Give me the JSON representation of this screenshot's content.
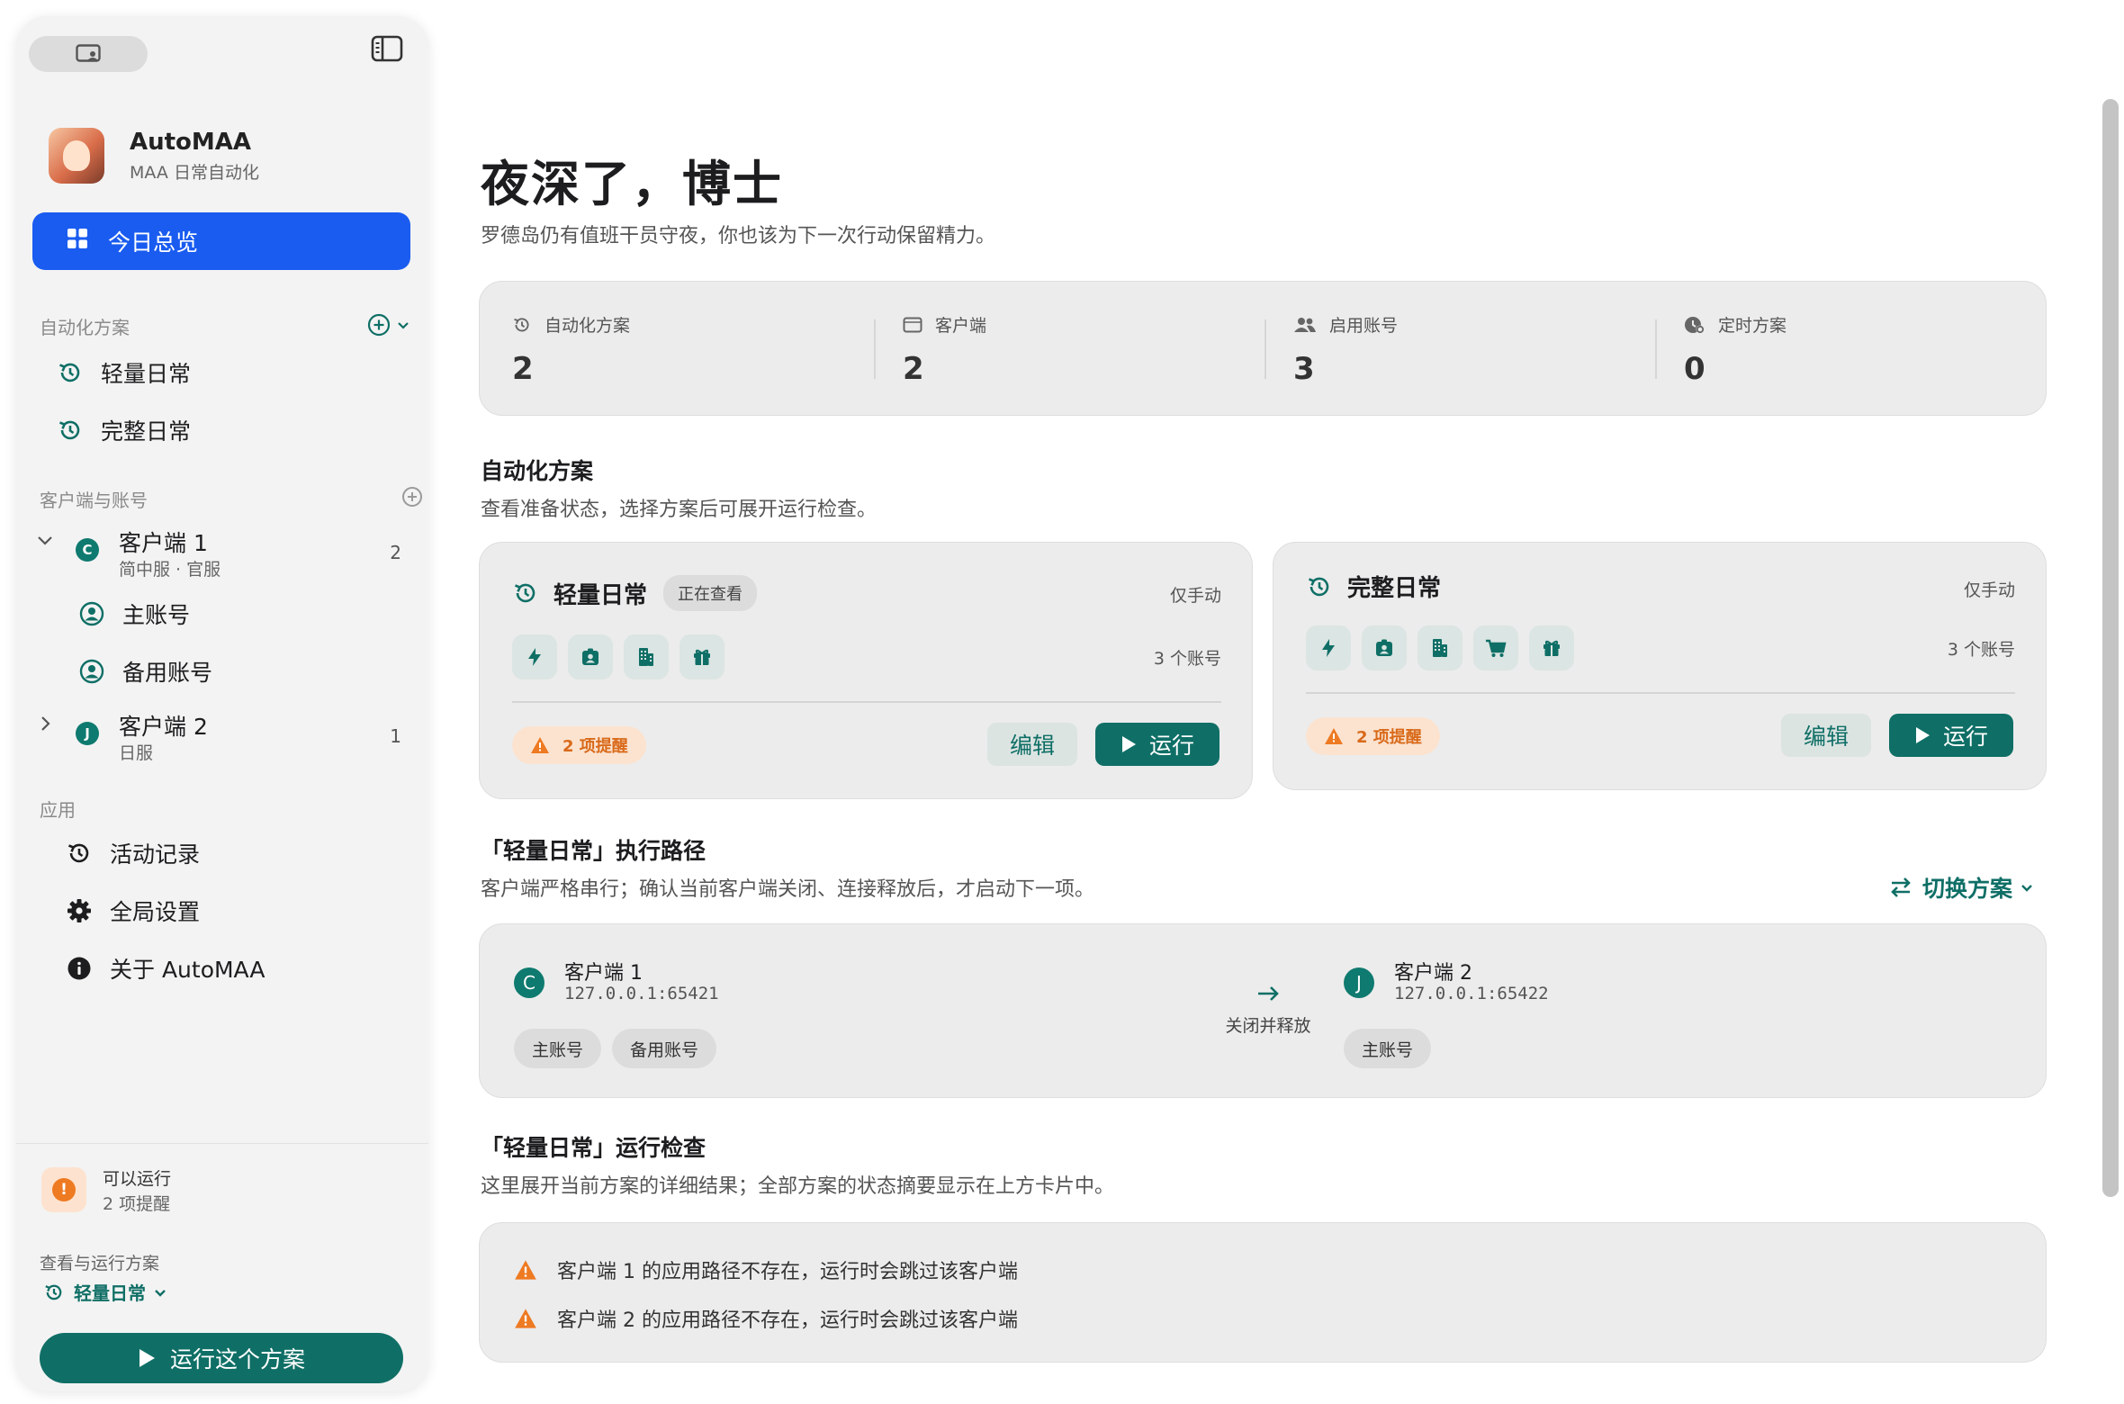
{
  "sidebar": {
    "app": {
      "name": "AutoMAA",
      "subtitle": "MAA 日常自动化"
    },
    "nav_active": "今日总览",
    "sections": {
      "plans": "自动化方案",
      "clients": "客户端与账号",
      "app": "应用"
    },
    "plans": [
      {
        "label": "轻量日常",
        "icon": "history-icon"
      },
      {
        "label": "完整日常",
        "icon": "history-icon"
      }
    ],
    "clients": [
      {
        "badge": "C",
        "name": "客户端 1",
        "sub": "简中服 · 官服",
        "count": "2",
        "expanded": true,
        "accounts": [
          "主账号",
          "备用账号"
        ]
      },
      {
        "badge": "J",
        "name": "客户端 2",
        "sub": "日服",
        "count": "1",
        "expanded": false
      }
    ],
    "app_items": [
      {
        "label": "活动记录",
        "icon": "history-icon"
      },
      {
        "label": "全局设置",
        "icon": "gear-icon"
      },
      {
        "label": "关于 AutoMAA",
        "icon": "info-icon"
      }
    ],
    "footer": {
      "status": "可以运行",
      "warnings": "2 项提醒",
      "view_label": "查看与运行方案",
      "selected_plan": "轻量日常",
      "run_button": "运行这个方案"
    }
  },
  "main": {
    "greeting": "夜深了，博士",
    "greeting_sub": "罗德岛仍有值班干员守夜，你也该为下一次行动保留精力。",
    "stats": [
      {
        "label": "自动化方案",
        "value": "2",
        "icon": "history-icon"
      },
      {
        "label": "客户端",
        "value": "2",
        "icon": "window-icon"
      },
      {
        "label": "启用账号",
        "value": "3",
        "icon": "users-icon"
      },
      {
        "label": "定时方案",
        "value": "0",
        "icon": "timer-icon"
      }
    ],
    "plans_section": {
      "title": "自动化方案",
      "desc": "查看准备状态，选择方案后可展开运行检查。"
    },
    "plan_cards": [
      {
        "name": "轻量日常",
        "viewing": "正在查看",
        "mode": "仅手动",
        "accounts": "3 个账号",
        "icons": [
          "bolt-icon",
          "badge-icon",
          "building-icon",
          "gift-icon"
        ],
        "warnings": "2 项提醒",
        "edit": "编辑",
        "run": "运行"
      },
      {
        "name": "完整日常",
        "viewing": "",
        "mode": "仅手动",
        "accounts": "3 个账号",
        "icons": [
          "bolt-icon",
          "badge-icon",
          "building-icon",
          "cart-icon",
          "gift-icon"
        ],
        "warnings": "2 项提醒",
        "edit": "编辑",
        "run": "运行"
      }
    ],
    "path_section": {
      "title": "「轻量日常」执行路径",
      "desc": "客户端严格串行；确认当前客户端关闭、连接释放后，才启动下一项。",
      "switch": "切换方案",
      "nodes": [
        {
          "badge": "C",
          "name": "客户端 1",
          "addr": "127.0.0.1:65421",
          "accounts": [
            "主账号",
            "备用账号"
          ]
        },
        {
          "badge": "J",
          "name": "客户端 2",
          "addr": "127.0.0.1:65422",
          "accounts": [
            "主账号"
          ]
        }
      ],
      "arrow_label": "关闭并释放"
    },
    "check_section": {
      "title": "「轻量日常」运行检查",
      "desc": "这里展开当前方案的详细结果；全部方案的状态摘要显示在上方卡片中。",
      "items": [
        "客户端 1 的应用路径不存在，运行时会跳过该客户端",
        "客户端 2 的应用路径不存在，运行时会跳过该客户端"
      ]
    }
  },
  "colors": {
    "primary": "#1a5cf0",
    "teal": "#0f6f66",
    "warning": "#ee7a22"
  }
}
